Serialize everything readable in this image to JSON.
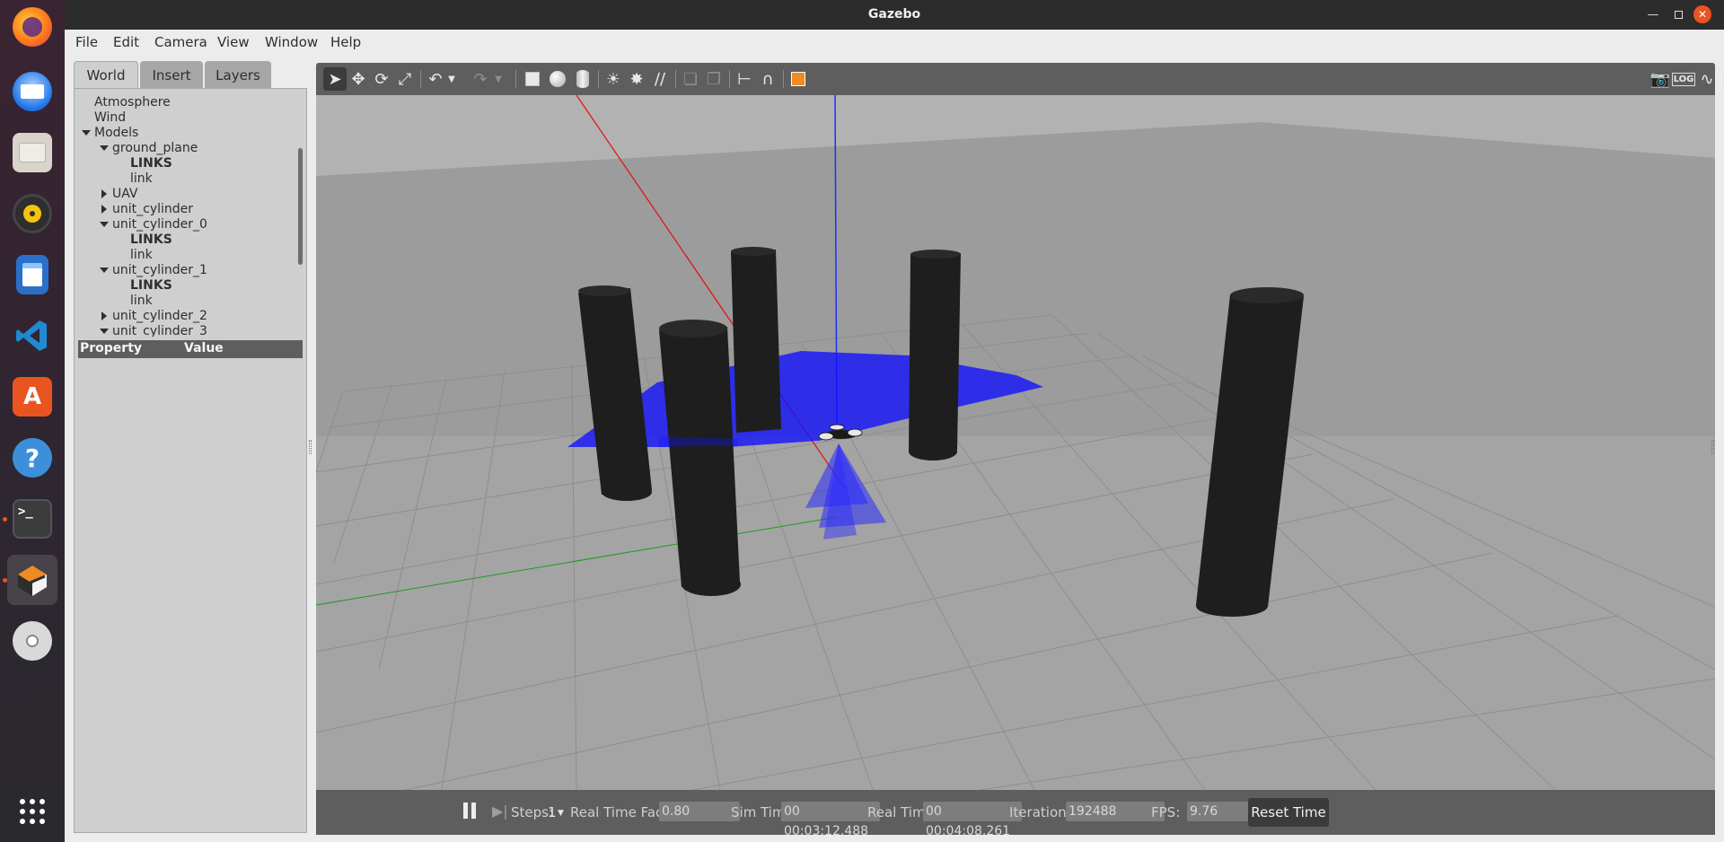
{
  "app": {
    "window_title": "Gazebo",
    "accent": "#e95420"
  },
  "dock": {
    "items": [
      {
        "name": "Firefox",
        "icon": "firefox-icon"
      },
      {
        "name": "Thunderbird",
        "icon": "thunderbird-icon"
      },
      {
        "name": "Files",
        "icon": "files-icon"
      },
      {
        "name": "Rhythmbox",
        "icon": "rhythmbox-icon"
      },
      {
        "name": "LibreOffice Writer",
        "icon": "writer-icon"
      },
      {
        "name": "Visual Studio Code",
        "icon": "vscode-icon"
      },
      {
        "name": "Ubuntu Software",
        "icon": "software-icon"
      },
      {
        "name": "Help",
        "icon": "help-icon"
      },
      {
        "name": "Terminal",
        "icon": "terminal-icon"
      },
      {
        "name": "Gazebo",
        "icon": "gazebo-icon"
      },
      {
        "name": "DVD",
        "icon": "dvd-icon"
      },
      {
        "name": "Show Applications",
        "icon": "apps-grid-icon"
      }
    ]
  },
  "menu": {
    "file": "File",
    "edit": "Edit",
    "camera": "Camera",
    "view": "View",
    "window": "Window",
    "help": "Help"
  },
  "left_panel": {
    "tabs": {
      "world": "World",
      "insert": "Insert",
      "layers": "Layers"
    },
    "tree": [
      "Atmosphere",
      "Wind",
      "Models",
      "ground_plane",
      "LINKS",
      "link",
      "UAV",
      "unit_cylinder",
      "unit_cylinder_0",
      "LINKS",
      "link",
      "unit_cylinder_1",
      "LINKS",
      "link",
      "unit_cylinder_2",
      "unit_cylinder_3"
    ],
    "property_header": {
      "property": "Property",
      "value": "Value"
    }
  },
  "toolbar": {
    "icons": [
      "select-arrow-icon",
      "translate-icon",
      "rotate-icon",
      "scale-icon",
      "undo-icon",
      "redo-icon",
      "box-icon",
      "sphere-icon",
      "cylinder-icon",
      "point-light-icon",
      "spot-light-icon",
      "directional-light-icon",
      "copy-icon",
      "paste-icon",
      "align-icon",
      "snap-icon",
      "view-angle-icon",
      "screenshot-icon",
      "log-icon",
      "plot-icon",
      "video-record-icon"
    ]
  },
  "bottom_bar": {
    "steps_label": "Steps:",
    "steps_value": "1",
    "rtf_label": "Real Time Factor:",
    "rtf_value": "0.80",
    "sim_time_label": "Sim Time:",
    "sim_time_value": "00 00:03:12.488",
    "real_time_label": "Real Time:",
    "real_time_value": "00 00:04:08.261",
    "iterations_label": "Iterations:",
    "iterations_value": "192488",
    "fps_label": "FPS:",
    "fps_value": "9.76",
    "reset_label": "Reset Time"
  }
}
